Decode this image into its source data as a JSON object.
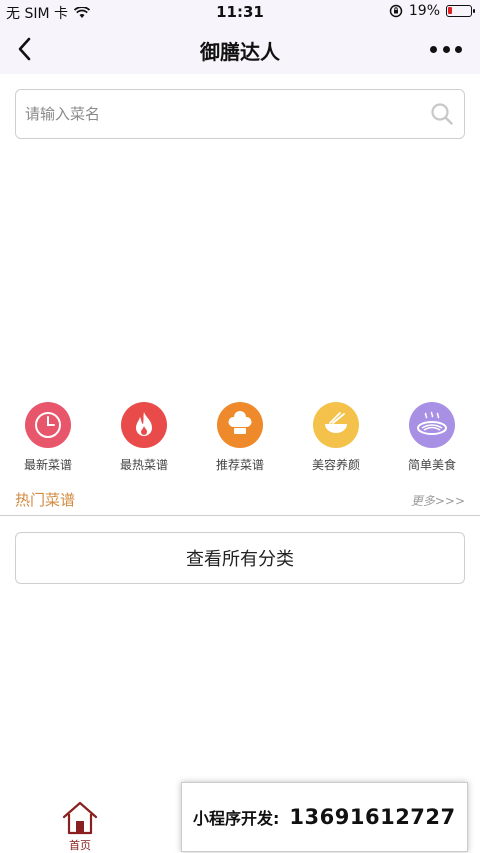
{
  "status_bar": {
    "carrier": "无 SIM 卡",
    "time": "11:31",
    "battery": "19%",
    "battery_level": 0.19
  },
  "nav": {
    "title": "御膳达人"
  },
  "search": {
    "placeholder": "请输入菜名"
  },
  "categories": [
    {
      "label": "最新菜谱",
      "icon": "clock-icon",
      "color": "#e8566b"
    },
    {
      "label": "最热菜谱",
      "icon": "flame-icon",
      "color": "#e94b4b"
    },
    {
      "label": "推荐菜谱",
      "icon": "chef-hat-icon",
      "color": "#ef8a2c"
    },
    {
      "label": "美容养颜",
      "icon": "bowl-icon",
      "color": "#f4c24a"
    },
    {
      "label": "简单美食",
      "icon": "plate-icon",
      "color": "#a890e4"
    }
  ],
  "hot_section": {
    "title": "热门菜谱",
    "more": "更多>>>"
  },
  "all_categories_button": "查看所有分类",
  "tabbar": {
    "home_label": "首页",
    "active_color": "#8a1f1f"
  },
  "ad_banner": {
    "label": "小程序开发:",
    "phone": "13691612727"
  }
}
